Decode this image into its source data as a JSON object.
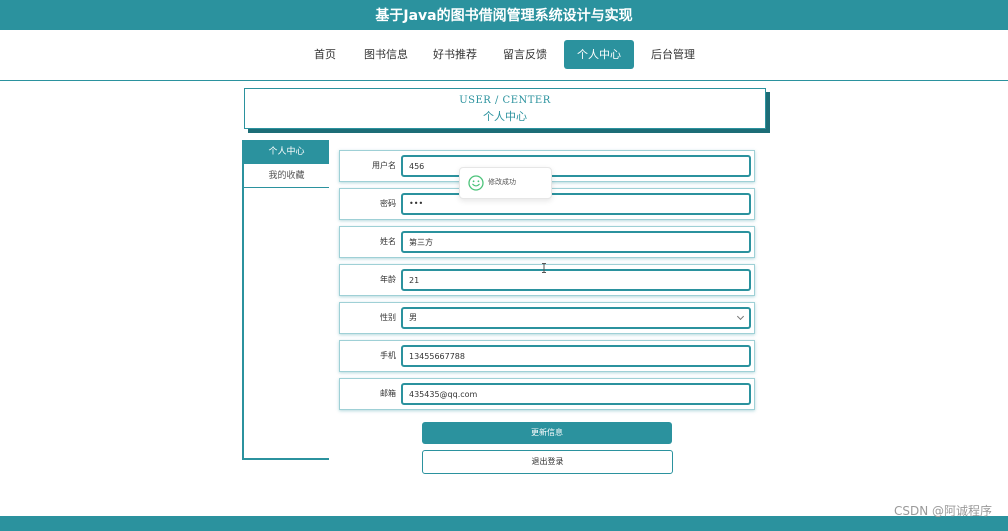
{
  "header": {
    "site_title": "基于Java的图书借阅管理系统设计与实现"
  },
  "nav": {
    "items": [
      {
        "label": "首页"
      },
      {
        "label": "图书信息"
      },
      {
        "label": "好书推荐"
      },
      {
        "label": "留言反馈"
      },
      {
        "label": "个人中心",
        "active": true
      },
      {
        "label": "后台管理"
      }
    ]
  },
  "center_title": {
    "en": "USER / CENTER",
    "zh": "个人中心"
  },
  "sidebar": {
    "items": [
      {
        "label": "个人中心",
        "active": true
      },
      {
        "label": "我的收藏"
      }
    ]
  },
  "form": {
    "username": {
      "label": "用户名",
      "value": "456"
    },
    "password": {
      "label": "密码",
      "value": "•••"
    },
    "name": {
      "label": "姓名",
      "value": "第三方"
    },
    "age": {
      "label": "年龄",
      "value": "21"
    },
    "gender": {
      "label": "性别",
      "value": "男"
    },
    "phone": {
      "label": "手机",
      "value": "13455667788"
    },
    "email": {
      "label": "邮箱",
      "value": "435435@qq.com"
    }
  },
  "buttons": {
    "update": "更新信息",
    "logout": "退出登录"
  },
  "toast": {
    "message": "修改成功",
    "icon": "smile-icon"
  },
  "watermark": "CSDN @阿诚程序",
  "colors": {
    "accent": "#2b929e",
    "toast_icon": "#4cc37a"
  }
}
